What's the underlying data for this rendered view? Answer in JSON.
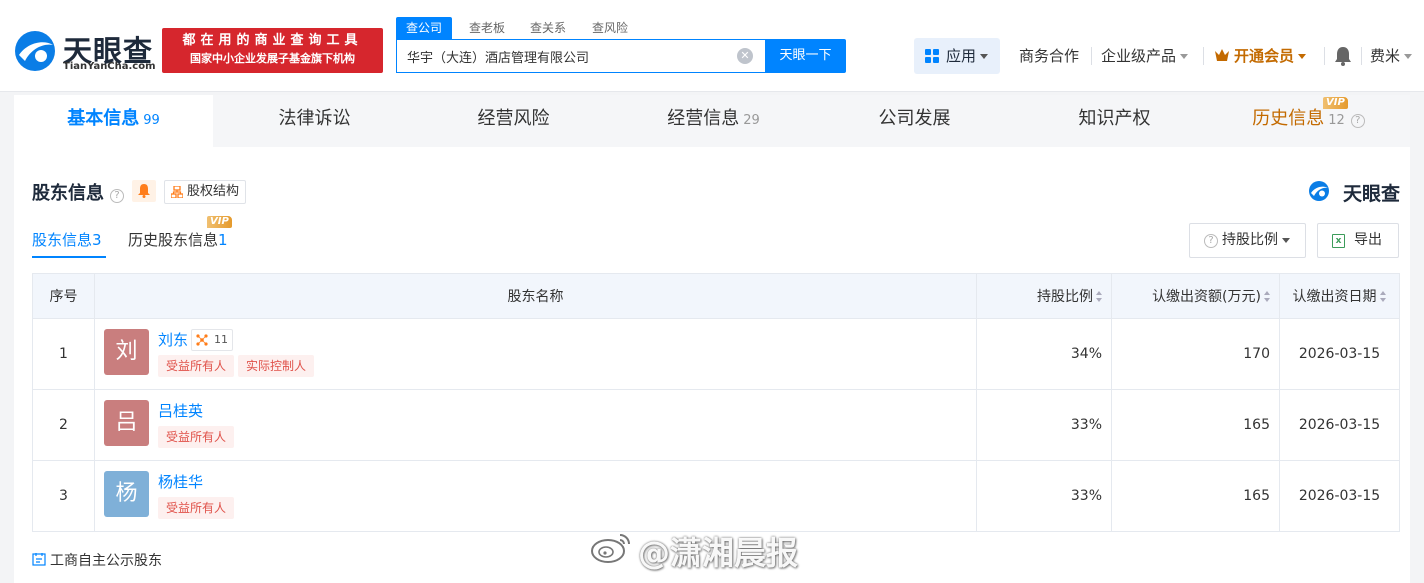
{
  "header": {
    "logo_text": "天眼查",
    "logo_domain": "TianYanCha.com",
    "slogan_line1": "都在用的商业查询工具",
    "slogan_line2": "国家中小企业发展子基金旗下机构",
    "search_tabs": [
      "查公司",
      "查老板",
      "查关系",
      "查风险"
    ],
    "search_value": "华宇（大连）酒店管理有限公司",
    "search_button": "天眼一下",
    "apps_label": "应用",
    "nav": [
      "商务合作",
      "企业级产品",
      "开通会员",
      "费米"
    ]
  },
  "tabs": [
    {
      "label": "基本信息",
      "count": "99"
    },
    {
      "label": "法律诉讼",
      "count": ""
    },
    {
      "label": "经营风险",
      "count": ""
    },
    {
      "label": "经营信息",
      "count": "29"
    },
    {
      "label": "公司发展",
      "count": ""
    },
    {
      "label": "知识产权",
      "count": ""
    },
    {
      "label": "历史信息",
      "count": "12"
    }
  ],
  "vip_badge": "VIP",
  "section": {
    "title": "股东信息",
    "equity_button": "股权结构",
    "brand": "天眼查",
    "subtabs": [
      {
        "label": "股东信息",
        "count": "3"
      },
      {
        "label": "历史股东信息",
        "count": "1"
      }
    ],
    "ratio_button": "持股比例",
    "export_button": "导出"
  },
  "table": {
    "headers": [
      "序号",
      "股东名称",
      "持股比例",
      "认缴出资额(万元)",
      "认缴出资日期"
    ],
    "rows": [
      {
        "idx": "1",
        "avatar": "刘",
        "avatar_color": "#c97e7e",
        "name": "刘东",
        "relations": "11",
        "tags": [
          "受益所有人",
          "实际控制人"
        ],
        "ratio": "34%",
        "amount": "170",
        "date": "2026-03-15"
      },
      {
        "idx": "2",
        "avatar": "吕",
        "avatar_color": "#c97e7e",
        "name": "吕桂英",
        "relations": "",
        "tags": [
          "受益所有人"
        ],
        "ratio": "33%",
        "amount": "165",
        "date": "2026-03-15"
      },
      {
        "idx": "3",
        "avatar": "杨",
        "avatar_color": "#7fb0d8",
        "name": "杨桂华",
        "relations": "",
        "tags": [
          "受益所有人"
        ],
        "ratio": "33%",
        "amount": "165",
        "date": "2026-03-15"
      }
    ]
  },
  "footer_note": "工商自主公示股东",
  "watermark": "@潇湘晨报",
  "colors": {
    "accent": "#0084ff",
    "brand_red": "#d6262d",
    "vip_orange": "#c36a00",
    "tag_red": "#e0524a"
  }
}
